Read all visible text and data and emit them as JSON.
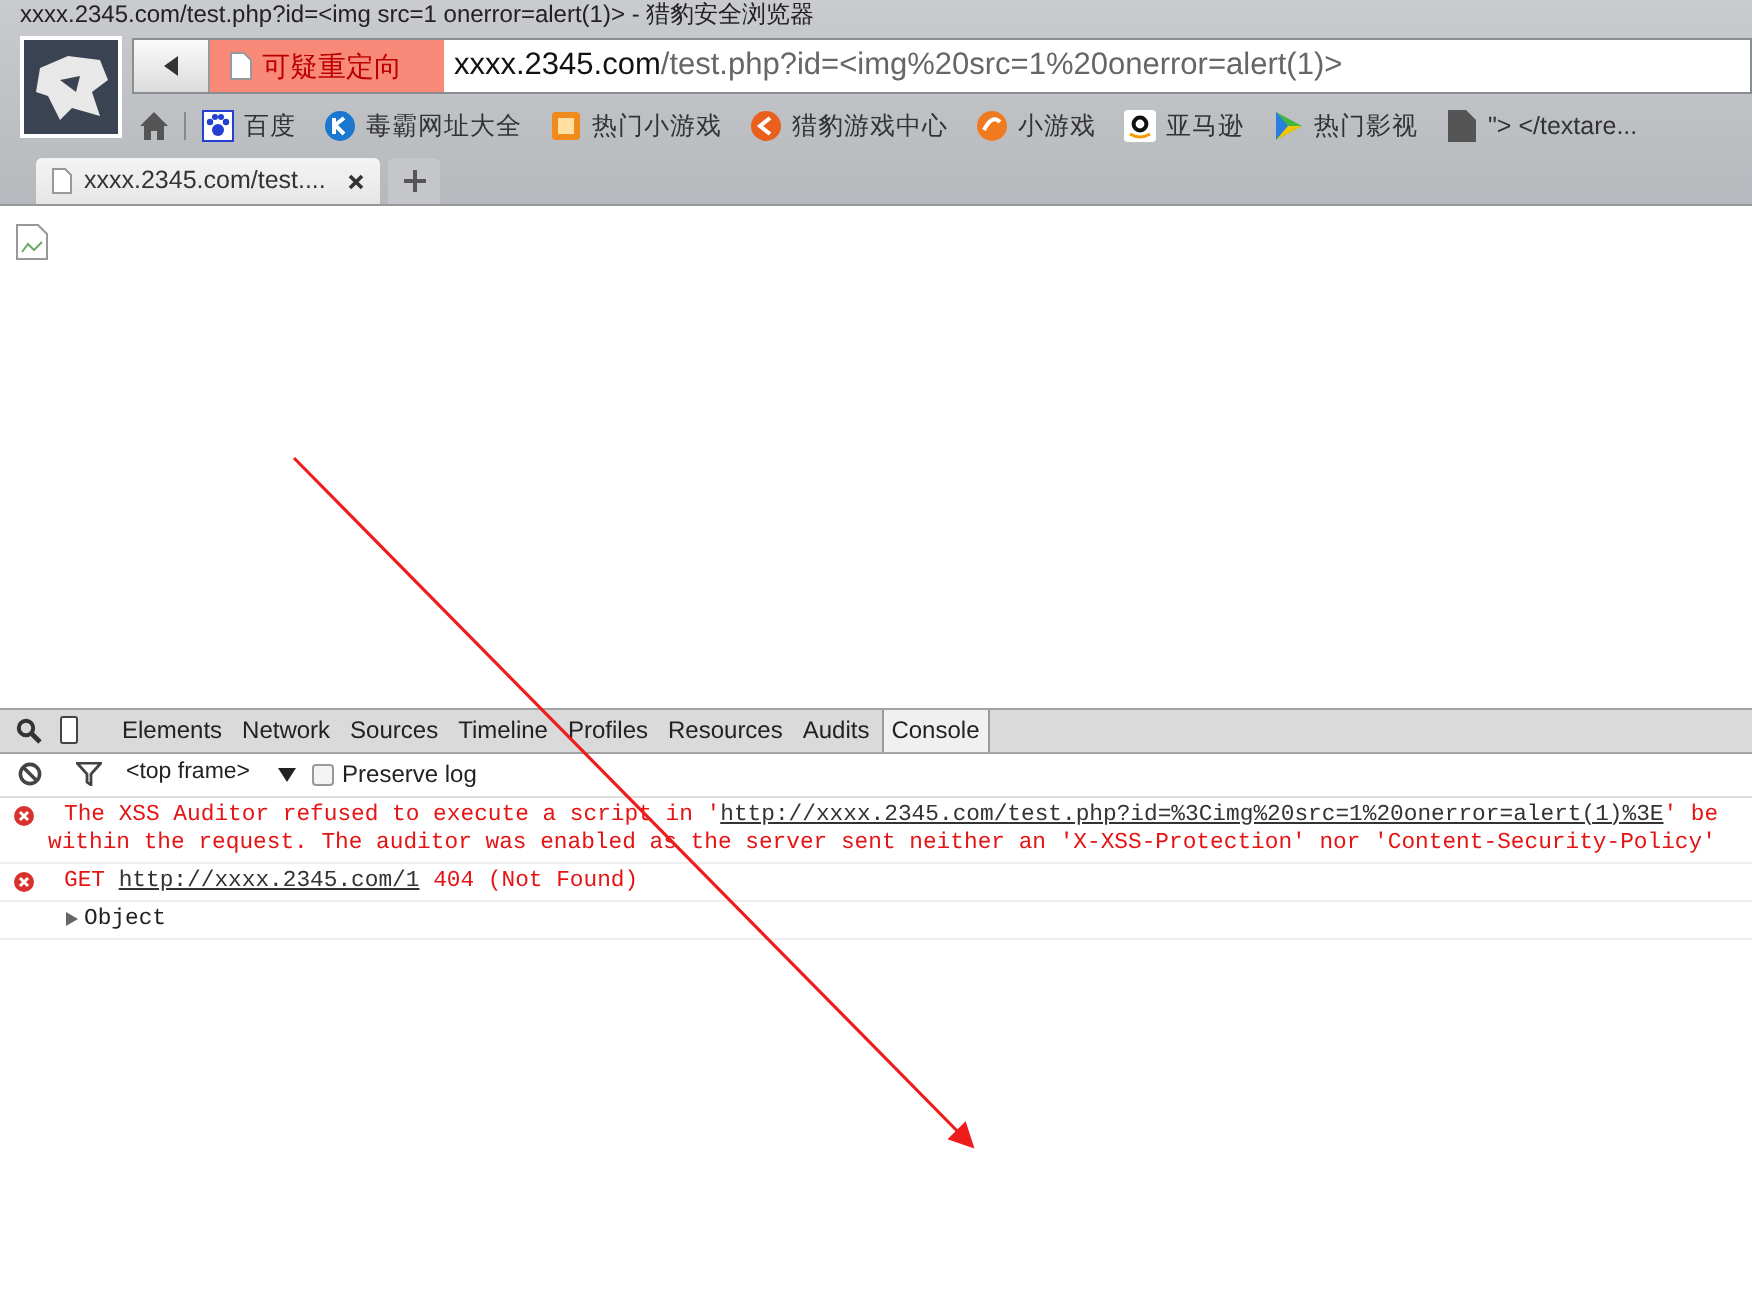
{
  "window": {
    "title": "xxxx.2345.com/test.php?id=<img src=1 onerror=alert(1)> - 猎豹安全浏览器"
  },
  "address_bar": {
    "warning": "可疑重定向",
    "url_host": "xxxx.2345.com",
    "url_path": "/test.php?id=<img%20src=1%20onerror=alert(1)>"
  },
  "bookmarks": [
    {
      "label": "百度",
      "kind": "paw"
    },
    {
      "label": "毒霸网址大全",
      "kind": "k"
    },
    {
      "label": "热门小游戏",
      "kind": "game"
    },
    {
      "label": "猎豹游戏中心",
      "kind": "orange"
    },
    {
      "label": "小游戏",
      "kind": "swirl"
    },
    {
      "label": "亚马逊",
      "kind": "amazon"
    },
    {
      "label": "热门影视",
      "kind": "play"
    },
    {
      "label": "\"> </textare...",
      "kind": "page"
    }
  ],
  "tabs": [
    {
      "label": "xxxx.2345.com/test....",
      "selected": true
    }
  ],
  "devtools": {
    "tabs": [
      {
        "label": "Elements",
        "selected": false
      },
      {
        "label": "Network",
        "selected": false
      },
      {
        "label": "Sources",
        "selected": false
      },
      {
        "label": "Timeline",
        "selected": false
      },
      {
        "label": "Profiles",
        "selected": false
      },
      {
        "label": "Resources",
        "selected": false
      },
      {
        "label": "Audits",
        "selected": false
      },
      {
        "label": "Console",
        "selected": true
      }
    ],
    "frame": "<top frame>",
    "preserve_log": {
      "label": "Preserve log",
      "checked": false
    },
    "messages": [
      {
        "kind": "error",
        "before": "The XSS Auditor refused to execute a script in '",
        "link": "http://xxxx.2345.com/test.php?id=%3Cimg%20src=1%20onerror=alert(1)%3E",
        "after": "' be",
        "line2": "within the request. The auditor was enabled as the server sent neither an 'X-XSS-Protection' nor 'Content-Security-Policy'"
      },
      {
        "kind": "error",
        "before": "GET ",
        "link": "http://xxxx.2345.com/1",
        "after": " 404 (Not Found)"
      },
      {
        "kind": "object",
        "before": "Object"
      }
    ]
  }
}
